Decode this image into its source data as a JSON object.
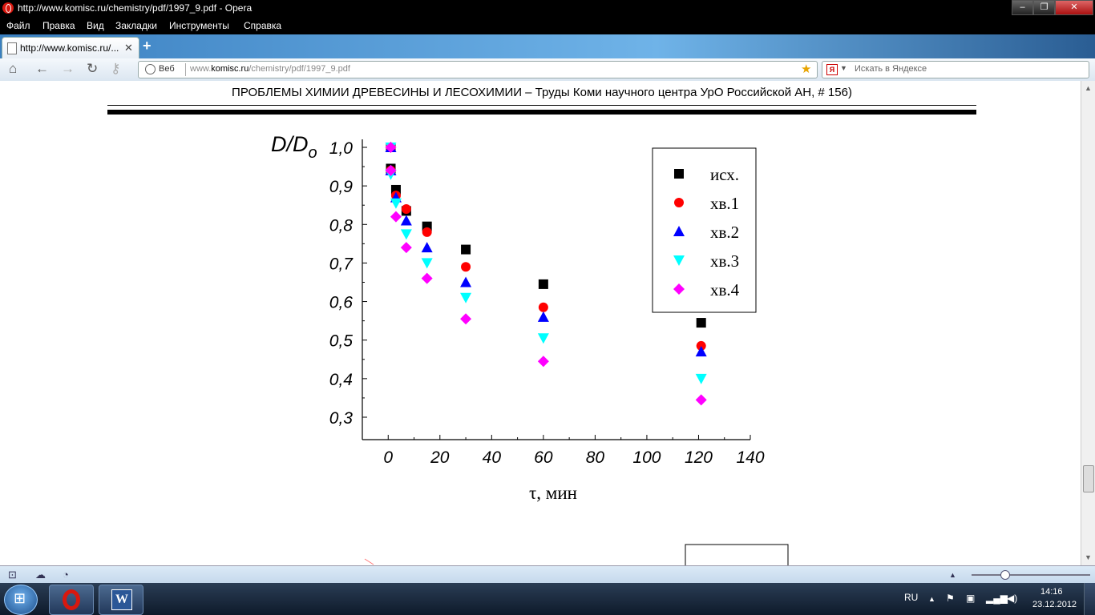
{
  "window": {
    "title": "http://www.komisc.ru/chemistry/pdf/1997_9.pdf - Opera",
    "buttons": {
      "minimize": "‒",
      "maximize": "❐",
      "close": "✕"
    }
  },
  "menu": [
    "Файл",
    "Правка",
    "Вид",
    "Закладки",
    "Инструменты",
    "Справка"
  ],
  "tab": {
    "label": "http://www.komisc.ru/...",
    "close": "✕",
    "new_tab": "+"
  },
  "nav": {
    "web_label": "Веб",
    "url_prefix": "www.",
    "url_domain": "komisc.ru",
    "url_path": "/chemistry/pdf/1997_9.pdf",
    "search_placeholder": "Искать в Яндексе",
    "search_engine_glyph": "Я"
  },
  "document": {
    "header": "ПРОБЛЕМЫ ХИМИИ ДРЕВЕСИНЫ И ЛЕСОХИМИИ  – Труды Коми научного центра УрО Российской АН, # 156)"
  },
  "chart_data": {
    "type": "scatter",
    "title": "",
    "ylabel_main": "D/D",
    "ylabel_sub": "o",
    "xlabel": "τ, мин",
    "xlim": [
      -10,
      140
    ],
    "ylim": [
      0.3,
      1.0
    ],
    "xticks": [
      0,
      20,
      40,
      60,
      80,
      100,
      120,
      140
    ],
    "yticks": [
      0.3,
      0.4,
      0.5,
      0.6,
      0.7,
      0.8,
      0.9,
      1.0
    ],
    "yticklabels": [
      "0,3",
      "0,4",
      "0,5",
      "0,6",
      "0,7",
      "0,8",
      "0,9",
      "1,0"
    ],
    "xticklabels": [
      "0",
      "20",
      "40",
      "60",
      "80",
      "100",
      "120",
      "140"
    ],
    "legend_position": "top-right",
    "series": [
      {
        "name": "исх.",
        "marker": "square",
        "color": "#000000",
        "x": [
          1,
          1,
          3,
          7,
          15,
          30,
          60,
          121
        ],
        "y": [
          1.0,
          0.945,
          0.89,
          0.835,
          0.795,
          0.735,
          0.645,
          0.545
        ]
      },
      {
        "name": "хв.1",
        "marker": "circle",
        "color": "#ff0000",
        "x": [
          1,
          1,
          3,
          7,
          15,
          30,
          60,
          121
        ],
        "y": [
          1.0,
          0.94,
          0.875,
          0.84,
          0.78,
          0.69,
          0.585,
          0.485
        ]
      },
      {
        "name": "хв.2",
        "marker": "triangle-up",
        "color": "#0000ff",
        "x": [
          1,
          1,
          3,
          7,
          15,
          30,
          60,
          121
        ],
        "y": [
          1.0,
          0.94,
          0.87,
          0.81,
          0.74,
          0.65,
          0.56,
          0.47
        ]
      },
      {
        "name": "хв.3",
        "marker": "triangle-down",
        "color": "#00ffff",
        "x": [
          1,
          1,
          3,
          7,
          15,
          30,
          60,
          121
        ],
        "y": [
          1.0,
          0.93,
          0.855,
          0.775,
          0.7,
          0.61,
          0.505,
          0.4
        ]
      },
      {
        "name": "хв.4",
        "marker": "diamond",
        "color": "#ff00ff",
        "x": [
          1,
          1,
          3,
          7,
          15,
          30,
          60,
          121
        ],
        "y": [
          1.0,
          0.94,
          0.82,
          0.74,
          0.66,
          0.555,
          0.445,
          0.345
        ]
      }
    ]
  },
  "taskbar": {
    "language": "RU",
    "time": "14:16",
    "date": "23.12.2012"
  }
}
